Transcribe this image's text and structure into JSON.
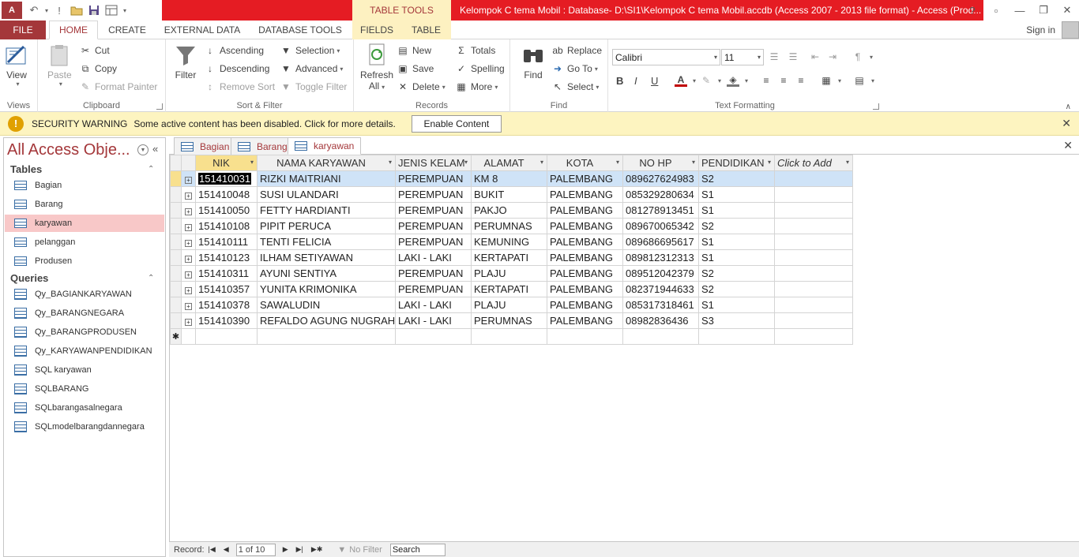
{
  "window": {
    "title": "Kelompok C tema Mobil : Database- D:\\SI1\\Kelompok C tema Mobil.accdb (Access 2007 - 2013 file format) -  Access (Prod...",
    "app_logo": "A",
    "context_tab_group": "TABLE TOOLS",
    "help": "?",
    "restore": "▫",
    "minimize": "—",
    "maximize": "❐",
    "close": "✕"
  },
  "ribbon_tabs": {
    "file": "FILE",
    "home": "HOME",
    "create": "CREATE",
    "external_data": "EXTERNAL DATA",
    "database_tools": "DATABASE TOOLS",
    "fields": "FIELDS",
    "table": "TABLE",
    "sign_in": "Sign in"
  },
  "ribbon": {
    "views": {
      "label": "Views",
      "view": "View"
    },
    "clipboard": {
      "label": "Clipboard",
      "paste": "Paste",
      "cut": "Cut",
      "copy": "Copy",
      "format_painter": "Format Painter"
    },
    "sort_filter": {
      "label": "Sort & Filter",
      "filter": "Filter",
      "ascending": "Ascending",
      "descending": "Descending",
      "remove_sort": "Remove Sort",
      "selection": "Selection",
      "advanced": "Advanced",
      "toggle_filter": "Toggle Filter"
    },
    "records": {
      "label": "Records",
      "refresh": "Refresh",
      "refresh_all": "All",
      "new": "New",
      "save": "Save",
      "delete": "Delete",
      "totals": "Totals",
      "spelling": "Spelling",
      "more": "More"
    },
    "find": {
      "label": "Find",
      "find": "Find",
      "replace": "Replace",
      "go_to": "Go To",
      "select": "Select"
    },
    "text_formatting": {
      "label": "Text Formatting",
      "font_name": "Calibri",
      "font_size": "11",
      "bold": "B",
      "italic": "I",
      "underline": "U"
    }
  },
  "security_bar": {
    "title": "SECURITY WARNING",
    "message": "Some active content has been disabled. Click for more details.",
    "button": "Enable Content"
  },
  "nav_pane": {
    "title": "All Access Obje...",
    "tables_header": "Tables",
    "tables": [
      "Bagian",
      "Barang",
      "karyawan",
      "pelanggan",
      "Produsen"
    ],
    "selected_table": "karyawan",
    "queries_header": "Queries",
    "queries": [
      "Qy_BAGIANKARYAWAN",
      "Qy_BARANGNEGARA",
      "Qy_BARANGPRODUSEN",
      "Qy_KARYAWANPENDIDIKAN",
      "SQL karyawan",
      "SQLBARANG",
      "SQLbarangasalnegara",
      "SQLmodelbarangdannegara"
    ]
  },
  "doc_tabs": [
    "Bagian",
    "Barang",
    "karyawan"
  ],
  "active_doc_tab": "karyawan",
  "datasheet": {
    "columns": [
      "NIK",
      "NAMA KARYAWAN",
      "JENIS KELAM",
      "ALAMAT",
      "KOTA",
      "NO HP",
      "PENDIDIKAN",
      "Click to Add"
    ],
    "rows": [
      [
        "151410031",
        "RIZKI MAITRIANI",
        "PEREMPUAN",
        "KM 8",
        "PALEMBANG",
        "089627624983",
        "S2"
      ],
      [
        "151410048",
        "SUSI ULANDARI",
        "PEREMPUAN",
        "BUKIT",
        "PALEMBANG",
        "085329280634",
        "S1"
      ],
      [
        "151410050",
        "FETTY HARDIANTI",
        "PEREMPUAN",
        "PAKJO",
        "PALEMBANG",
        "081278913451",
        "S1"
      ],
      [
        "151410108",
        "PIPIT PERUCA",
        "PEREMPUAN",
        "PERUMNAS",
        "PALEMBANG",
        "089670065342",
        "S2"
      ],
      [
        "151410111",
        "TENTI FELICIA",
        "PEREMPUAN",
        "KEMUNING",
        "PALEMBANG",
        "089686695617",
        "S1"
      ],
      [
        "151410123",
        "ILHAM SETIYAWAN",
        "LAKI - LAKI",
        "KERTAPATI",
        "PALEMBANG",
        "089812312313",
        "S1"
      ],
      [
        "151410311",
        "AYUNI SENTIYA",
        "PEREMPUAN",
        "PLAJU",
        "PALEMBANG",
        "089512042379",
        "S2"
      ],
      [
        "151410357",
        "YUNITA KRIMONIKA",
        "PEREMPUAN",
        "KERTAPATI",
        "PALEMBANG",
        "082371944633",
        "S2"
      ],
      [
        "151410378",
        "SAWALUDIN",
        "LAKI - LAKI",
        "PLAJU",
        "PALEMBANG",
        "085317318461",
        "S1"
      ],
      [
        "151410390",
        "REFALDO AGUNG NUGRAHA",
        "LAKI - LAKI",
        "PERUMNAS",
        "PALEMBANG",
        "08982836436",
        "S3"
      ]
    ],
    "new_row_marker": "✱"
  },
  "status_bar": {
    "record_label": "Record:",
    "record_position": "1 of 10",
    "no_filter": "No Filter",
    "search": "Search"
  },
  "colors": {
    "accent": "#a4373a",
    "title_band": "#e51c23",
    "context_tab": "#fdf1c1",
    "security_bar": "#fdf4c0",
    "selected_row": "#cfe3f7",
    "nav_selected": "#f8c8c8"
  }
}
